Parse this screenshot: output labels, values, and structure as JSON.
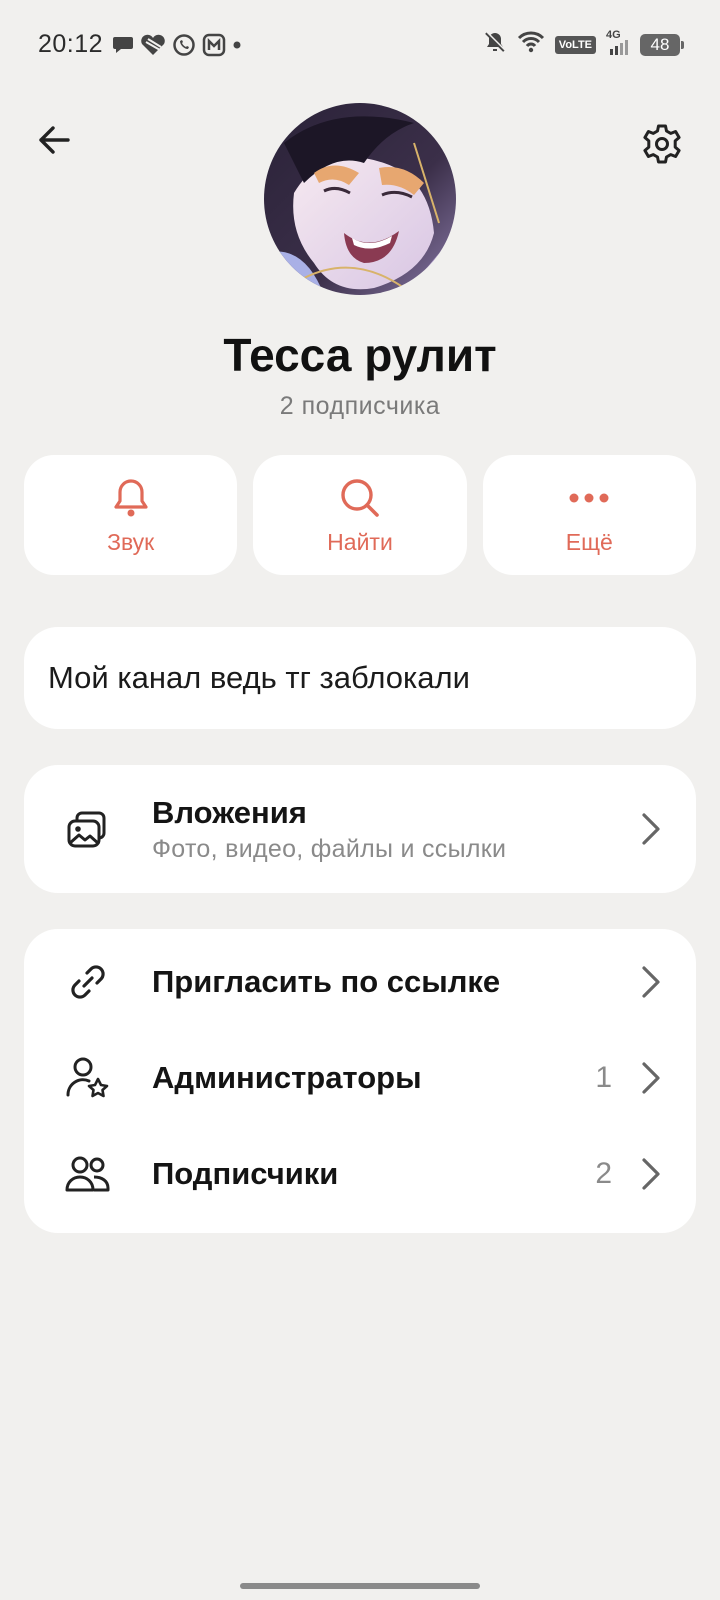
{
  "status_bar": {
    "time": "20:12",
    "network_badge": "VoLTE",
    "network_type": "4G",
    "battery": "48",
    "left_icons": [
      "chat-bubble-icon",
      "heart-icon",
      "whatsapp-icon",
      "max-app-icon",
      "dot-icon"
    ],
    "right_icons": [
      "bell-off-icon",
      "wifi-icon",
      "volte-icon",
      "signal-icon",
      "battery-icon"
    ]
  },
  "header": {
    "back_icon": "arrow-left-icon",
    "settings_icon": "gear-icon"
  },
  "channel": {
    "title": "Тесса рулит",
    "subscribers": "2 подписчика",
    "description": "Мой канал ведь тг заблокали"
  },
  "actions": [
    {
      "label": "Звук",
      "icon": "bell-icon"
    },
    {
      "label": "Найти",
      "icon": "search-icon"
    },
    {
      "label": "Ещё",
      "icon": "more-dots-icon"
    }
  ],
  "attachments": {
    "title": "Вложения",
    "subtitle": "Фото, видео, файлы и ссылки",
    "icon": "media-gallery-icon"
  },
  "menu": [
    {
      "label": "Пригласить по ссылке",
      "count": "",
      "icon": "link-icon"
    },
    {
      "label": "Администраторы",
      "count": "1",
      "icon": "admin-star-icon"
    },
    {
      "label": "Подписчики",
      "count": "2",
      "icon": "people-icon"
    }
  ],
  "colors": {
    "accent": "#e06a58",
    "background": "#f1f0ee",
    "card": "#ffffff",
    "text": "#111111",
    "secondary_text": "#8a8a8a"
  }
}
